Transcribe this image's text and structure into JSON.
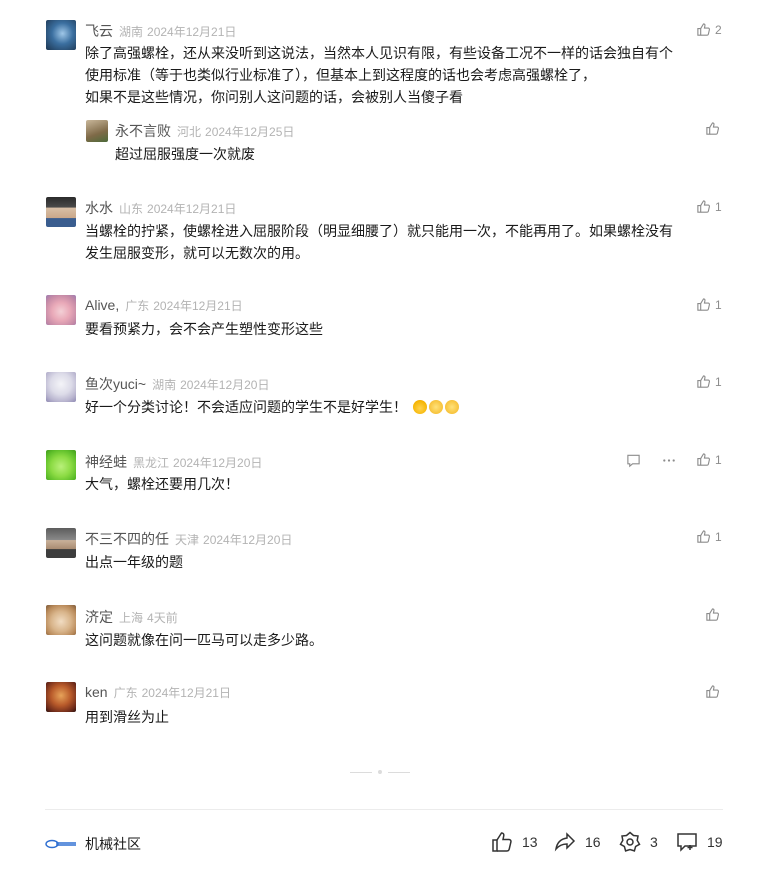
{
  "comments": [
    {
      "name": "飞云",
      "location": "湖南",
      "date": "2024年12月21日",
      "likes": "2",
      "lines": [
        "除了高强螺栓，还从来没听到这说法，当然本人见识有限，有些设备工况不一样的话会独自有个",
        "使用标准（等于也类似行业标准了），但基本上到这程度的话也会考虑高强螺栓了，",
        "如果不是这些情况，你问别人这问题的话，会被别人当傻子看"
      ],
      "reply": {
        "name": "永不言败",
        "location": "河北",
        "date": "2024年12月25日",
        "likes": "",
        "text": "超过屈服强度一次就废"
      }
    },
    {
      "name": "水水",
      "location": "山东",
      "date": "2024年12月21日",
      "likes": "1",
      "lines": [
        "当螺栓的拧紧，使螺栓进入屈服阶段（明显细腰了）就只能用一次，不能再用了。如果螺栓没有",
        "发生屈服变形，就可以无数次的用。"
      ]
    },
    {
      "name": "Alive,",
      "location": "广东",
      "date": "2024年12月21日",
      "likes": "1",
      "lines": [
        "要看预紧力，会不会产生塑性变形这些"
      ]
    },
    {
      "name": "鱼次yuci~",
      "location": "湖南",
      "date": "2024年12月20日",
      "likes": "1",
      "lines": [
        "好一个分类讨论！不会适应问题的学生不是好学生！"
      ]
    },
    {
      "name": "神经蛙",
      "location": "黑龙江",
      "date": "2024年12月20日",
      "likes": "1",
      "lines": [
        "大气，螺栓还要用几次！"
      ]
    },
    {
      "name": "不三不四的任",
      "location": "天津",
      "date": "2024年12月20日",
      "likes": "1",
      "lines": [
        "出点一年级的题"
      ]
    },
    {
      "name": "济定",
      "location": "上海",
      "date": "4天前",
      "likes": "",
      "lines": [
        "这问题就像在问一匹马可以走多少路。"
      ]
    },
    {
      "name": "ken",
      "location": "广东",
      "date": "2024年12月21日",
      "likes": "",
      "lines": [
        "用到滑丝为止"
      ]
    }
  ],
  "footer": {
    "brand": "机械社区",
    "likes": "13",
    "shares": "16",
    "favorites": "3",
    "comments": "19"
  },
  "icons": {
    "like": "thumbs-up-icon",
    "reply": "comment-icon",
    "more": "more-dots-icon",
    "share": "share-icon",
    "favorite": "favorite-icon",
    "comment": "comment-add-icon"
  }
}
